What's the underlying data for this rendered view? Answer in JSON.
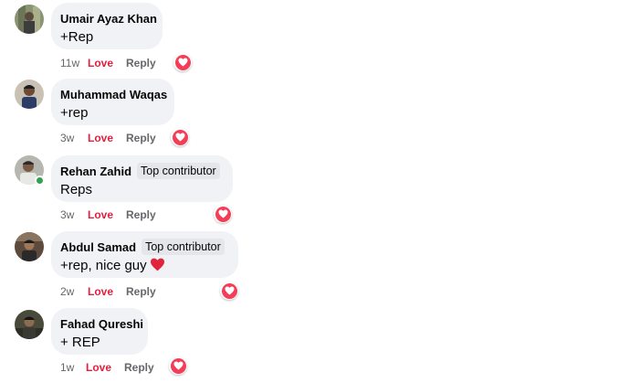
{
  "colors": {
    "bubble_bg": "#f0f2f5",
    "love": "#e41e3f",
    "meta": "#65676b",
    "reaction_bg": "#f33e58",
    "online": "#31a24c"
  },
  "comments": [
    {
      "author": "Umair Ayaz Khan",
      "badge": "",
      "text": "+Rep",
      "time": "11w",
      "love": "Love",
      "reply": "Reply",
      "reaction": "love-reaction-icon"
    },
    {
      "author": "Muhammad Waqas",
      "badge": "",
      "text": "+rep",
      "time": "3w",
      "love": "Love",
      "reply": "Reply",
      "reaction": "love-reaction-icon"
    },
    {
      "author": "Rehan Zahid",
      "badge": "Top contributor",
      "text": "Reps",
      "time": "3w",
      "love": "Love",
      "reply": "Reply",
      "reaction": "love-reaction-icon",
      "online": true
    },
    {
      "author": "Abdul Samad",
      "badge": "Top contributor",
      "text": "+rep, nice guy",
      "text_emoji": "red-heart-icon",
      "time": "2w",
      "love": "Love",
      "reply": "Reply",
      "reaction": "love-reaction-icon"
    },
    {
      "author": "Fahad Qureshi",
      "badge": "",
      "text": "+ REP",
      "time": "1w",
      "love": "Love",
      "reply": "Reply",
      "reaction": "love-reaction-icon"
    }
  ]
}
